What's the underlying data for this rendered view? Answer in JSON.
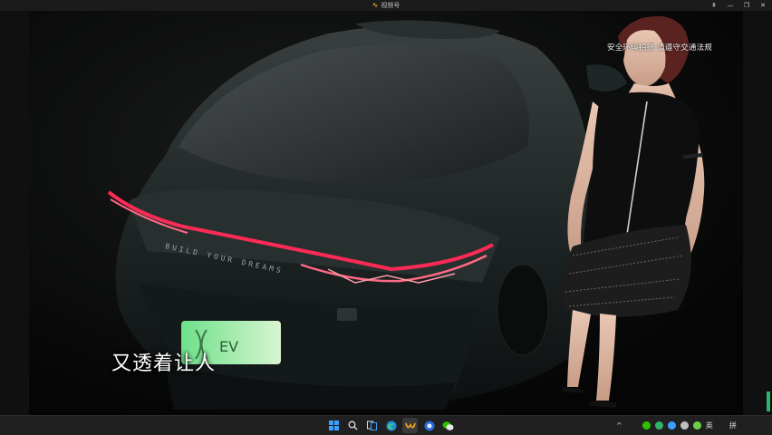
{
  "window": {
    "title": "视频号",
    "controls": [
      "pin",
      "minimize",
      "maximize",
      "close"
    ]
  },
  "video": {
    "watermark": "安全环境拍摄 请遵守交通法规",
    "subtitle": "又透着让人",
    "car_lettering": "BUILD YOUR DREAMS",
    "plate_text": "EV"
  },
  "taskbar": {
    "icons": [
      "windows-start-icon",
      "search-icon",
      "task-view-icon",
      "edge-icon",
      "channels-app-icon",
      "browser-icon",
      "wechat-icon"
    ],
    "tray": {
      "chevron": "^",
      "ime_lang": "英",
      "ime_mode": "拼"
    }
  },
  "colors": {
    "accent": "#f0a020",
    "tail_light": "#ff2a55",
    "wechat_green": "#2dc100"
  }
}
